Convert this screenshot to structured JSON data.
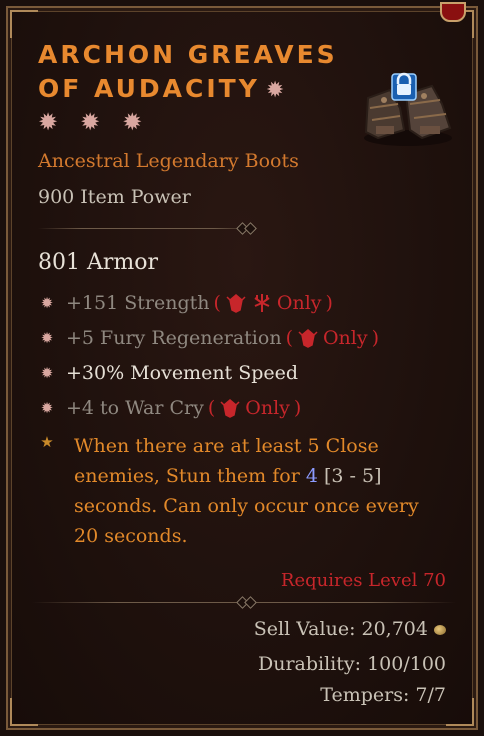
{
  "item": {
    "name_line1": "ARCHON GREAVES",
    "name_line2": "OF AUDACITY",
    "type": "Ancestral Legendary Boots",
    "item_power": "900 Item Power",
    "armor": "801 Armor",
    "affixes": [
      {
        "text": "+151 Strength",
        "restriction": "Only",
        "dim": true,
        "class_icons": [
          "barbarian-icon",
          "druid-icon"
        ]
      },
      {
        "text": "+5 Fury Regeneration",
        "restriction": "Only",
        "dim": true,
        "class_icons": [
          "barbarian-icon"
        ]
      },
      {
        "text": "+30% Movement Speed",
        "restriction": "",
        "dim": false,
        "class_icons": []
      },
      {
        "text": "+4 to War Cry",
        "restriction": "Only",
        "dim": true,
        "class_icons": [
          "barbarian-icon"
        ]
      }
    ],
    "legendary_power": {
      "part1": "When there are at least 5 Close enemies, Stun them for",
      "value": "4",
      "range": "[3 - 5]",
      "part2": "seconds. Can only occur once every 20 seconds."
    },
    "requires": "Requires Level 70",
    "sell_value": "Sell Value: 20,704",
    "durability": "Durability: 100/100",
    "tempers": "Tempers: 7/7",
    "locked": true
  },
  "colors": {
    "legendary_orange": "#e8892f",
    "restriction_red": "#c7262b",
    "value_blue": "#8c9bff"
  }
}
